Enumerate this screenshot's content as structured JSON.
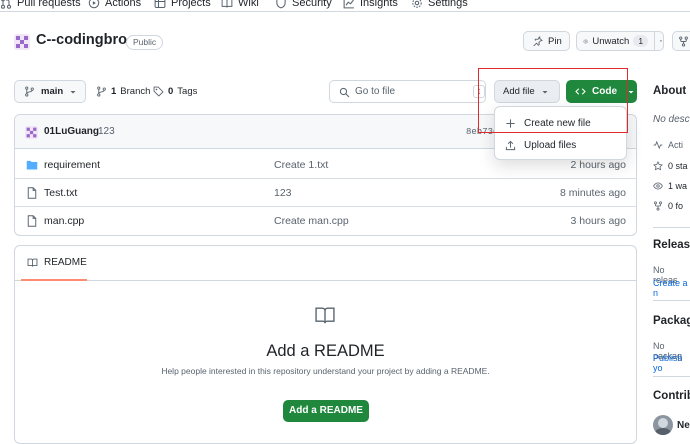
{
  "nav": {
    "items": [
      {
        "label": "Pull requests",
        "icon": "pull-request-icon"
      },
      {
        "label": "Actions",
        "icon": "play-icon"
      },
      {
        "label": "Projects",
        "icon": "table-icon"
      },
      {
        "label": "Wiki",
        "icon": "book-icon"
      },
      {
        "label": "Security",
        "icon": "shield-icon"
      },
      {
        "label": "Insights",
        "icon": "graph-icon"
      },
      {
        "label": "Settings",
        "icon": "gear-icon"
      }
    ]
  },
  "repo": {
    "name": "C--codingbro",
    "visibility": "Public",
    "pin_label": "Pin",
    "watch_label": "Unwatch",
    "watch_count": "1"
  },
  "toolbar": {
    "branch": "main",
    "branch_count": "1",
    "branch_label": "Branch",
    "tag_count": "0",
    "tag_label": "Tags",
    "goto_placeholder": "Go to file",
    "goto_shortcut": "t",
    "add_file_label": "Add file",
    "code_label": "Code"
  },
  "commit": {
    "author": "01LuGuang",
    "message": "123",
    "sha_partial": "8eb73c"
  },
  "files": [
    {
      "name": "requirement",
      "type": "folder",
      "message": "Create 1.txt",
      "age": "2 hours ago"
    },
    {
      "name": "Test.txt",
      "type": "file",
      "message": "123",
      "age": "8 minutes ago"
    },
    {
      "name": "man.cpp",
      "type": "file",
      "message": "Create man.cpp",
      "age": "3 hours ago"
    }
  ],
  "readme": {
    "tab_label": "README",
    "title": "Add a README",
    "description": "Help people interested in this repository understand your project by adding a README.",
    "button_label": "Add a README"
  },
  "dropdown": {
    "items": [
      {
        "label": "Create new file",
        "icon": "plus-icon"
      },
      {
        "label": "Upload files",
        "icon": "upload-icon"
      }
    ]
  },
  "sidebar": {
    "about_title": "About",
    "about_desc": "No desc",
    "activity": "Acti",
    "stars": "0 sta",
    "watching": "1 wa",
    "forks": "0 fo",
    "releases_title": "Releas",
    "releases_text": "No releas",
    "releases_link": "Create a n",
    "packages_title": "Packag",
    "packages_text": "No packag",
    "packages_link": "Publish yo",
    "contrib_title": "Contrib",
    "contrib_name": "Ne"
  },
  "colors": {
    "accent_green": "#1f883d",
    "highlight_red": "#e02b2b",
    "folder_blue": "#54aeff",
    "readme_underline": "#fd8c73",
    "avatar_purple": "#9a68c9"
  }
}
